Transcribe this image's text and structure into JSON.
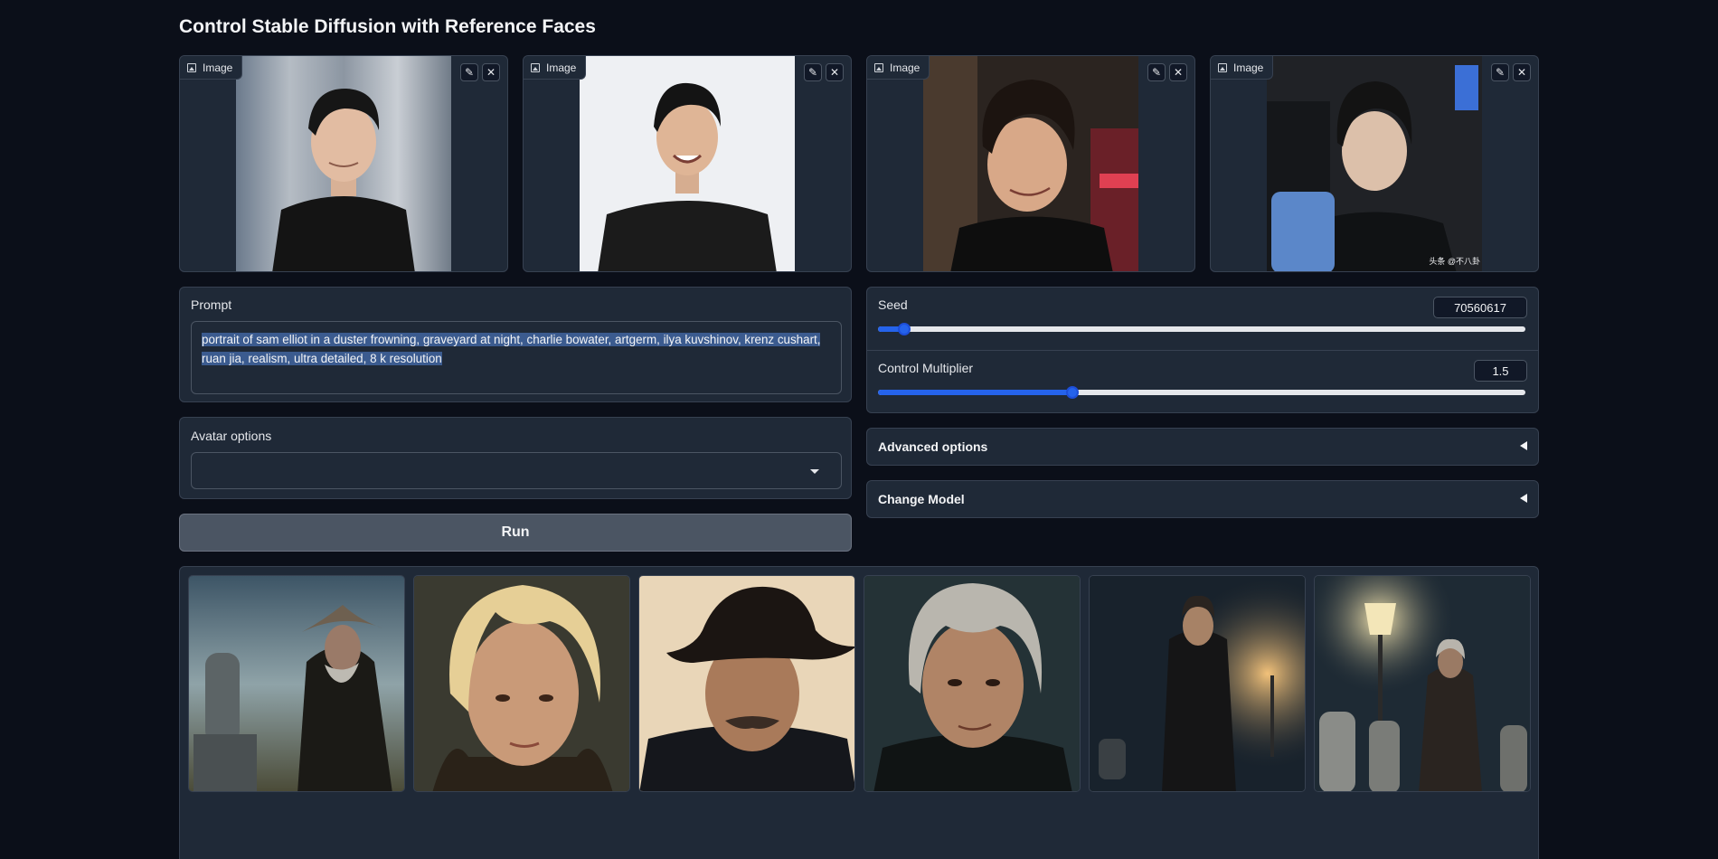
{
  "app": {
    "title": "Control Stable Diffusion with Reference Faces"
  },
  "reference_images": [
    {
      "label": "Image",
      "edit_icon": "pencil-icon",
      "clear_icon": "close-icon"
    },
    {
      "label": "Image",
      "edit_icon": "pencil-icon",
      "clear_icon": "close-icon"
    },
    {
      "label": "Image",
      "edit_icon": "pencil-icon",
      "clear_icon": "close-icon"
    },
    {
      "label": "Image",
      "edit_icon": "pencil-icon",
      "clear_icon": "close-icon",
      "watermark": "头条 @不八卦"
    }
  ],
  "prompt": {
    "label": "Prompt",
    "value": "portrait of sam elliot in a duster frowning, graveyard at night, charlie bowater, artgerm, ilya kuvshinov, krenz cushart, ruan jia, realism, ultra detailed, 8 k resolution"
  },
  "avatar_options": {
    "label": "Avatar options",
    "value": ""
  },
  "run_button": {
    "label": "Run"
  },
  "seed": {
    "label": "Seed",
    "value": "70560617",
    "fraction": 0.04
  },
  "control_multiplier": {
    "label": "Control Multiplier",
    "value": "1.5",
    "fraction": 0.3
  },
  "advanced_options": {
    "label": "Advanced options"
  },
  "change_model": {
    "label": "Change Model"
  },
  "gallery": {
    "count": 6
  },
  "colors": {
    "background": "#0b0f19",
    "panel": "#1f2937",
    "border": "#374151",
    "accent": "#2563eb",
    "selection": "#3b5b8f"
  }
}
